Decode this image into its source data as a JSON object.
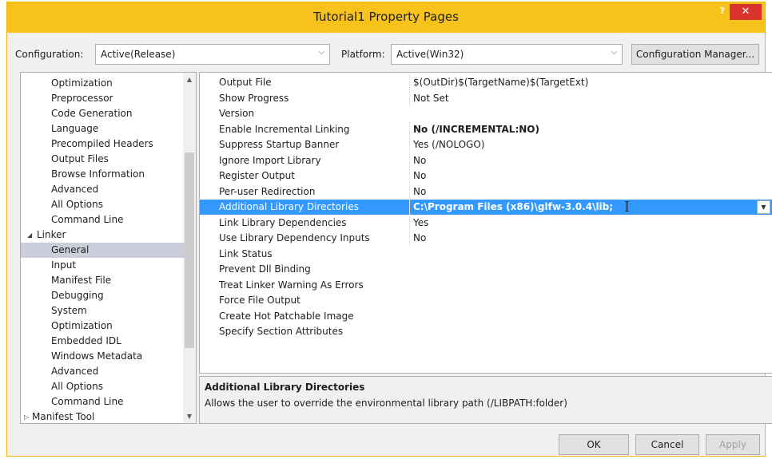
{
  "window": {
    "title": "Tutorial1 Property Pages",
    "help": "?",
    "close": "✕"
  },
  "config": {
    "configuration_label": "Configuration:",
    "configuration_value": "Active(Release)",
    "platform_label": "Platform:",
    "platform_value": "Active(Win32)",
    "manager_button": "Configuration Manager..."
  },
  "tree": {
    "items": [
      "Optimization",
      "Preprocessor",
      "Code Generation",
      "Language",
      "Precompiled Headers",
      "Output Files",
      "Browse Information",
      "Advanced",
      "All Options",
      "Command Line",
      "Linker",
      "General",
      "Input",
      "Manifest File",
      "Debugging",
      "System",
      "Optimization",
      "Embedded IDL",
      "Windows Metadata",
      "Advanced",
      "All Options",
      "Command Line",
      "Manifest Tool"
    ],
    "expanded_glyph": "◢",
    "collapsed_glyph": "▷"
  },
  "grid": {
    "rows": [
      {
        "name": "Output File",
        "value": "$(OutDir)$(TargetName)$(TargetExt)"
      },
      {
        "name": "Show Progress",
        "value": "Not Set"
      },
      {
        "name": "Version",
        "value": ""
      },
      {
        "name": "Enable Incremental Linking",
        "value": "No (/INCREMENTAL:NO)"
      },
      {
        "name": "Suppress Startup Banner",
        "value": "Yes (/NOLOGO)"
      },
      {
        "name": "Ignore Import Library",
        "value": "No"
      },
      {
        "name": "Register Output",
        "value": "No"
      },
      {
        "name": "Per-user Redirection",
        "value": "No"
      },
      {
        "name": "Additional Library Directories",
        "value": "C:\\Program Files (x86)\\glfw-3.0.4\\lib;"
      },
      {
        "name": "Link Library Dependencies",
        "value": "Yes"
      },
      {
        "name": "Use Library Dependency Inputs",
        "value": "No"
      },
      {
        "name": "Link Status",
        "value": ""
      },
      {
        "name": "Prevent Dll Binding",
        "value": ""
      },
      {
        "name": "Treat Linker Warning As Errors",
        "value": ""
      },
      {
        "name": "Force File Output",
        "value": ""
      },
      {
        "name": "Create Hot Patchable Image",
        "value": ""
      },
      {
        "name": "Specify Section Attributes",
        "value": ""
      }
    ]
  },
  "description": {
    "title": "Additional Library Directories",
    "text": "Allows the user to override the environmental library path (/LIBPATH:folder)"
  },
  "buttons": {
    "ok": "OK",
    "cancel": "Cancel",
    "apply": "Apply"
  },
  "colors": {
    "titlebar": "#f7c21b",
    "selection": "#3399ff",
    "tree_selection": "#cccedb",
    "close": "#d9342b"
  }
}
